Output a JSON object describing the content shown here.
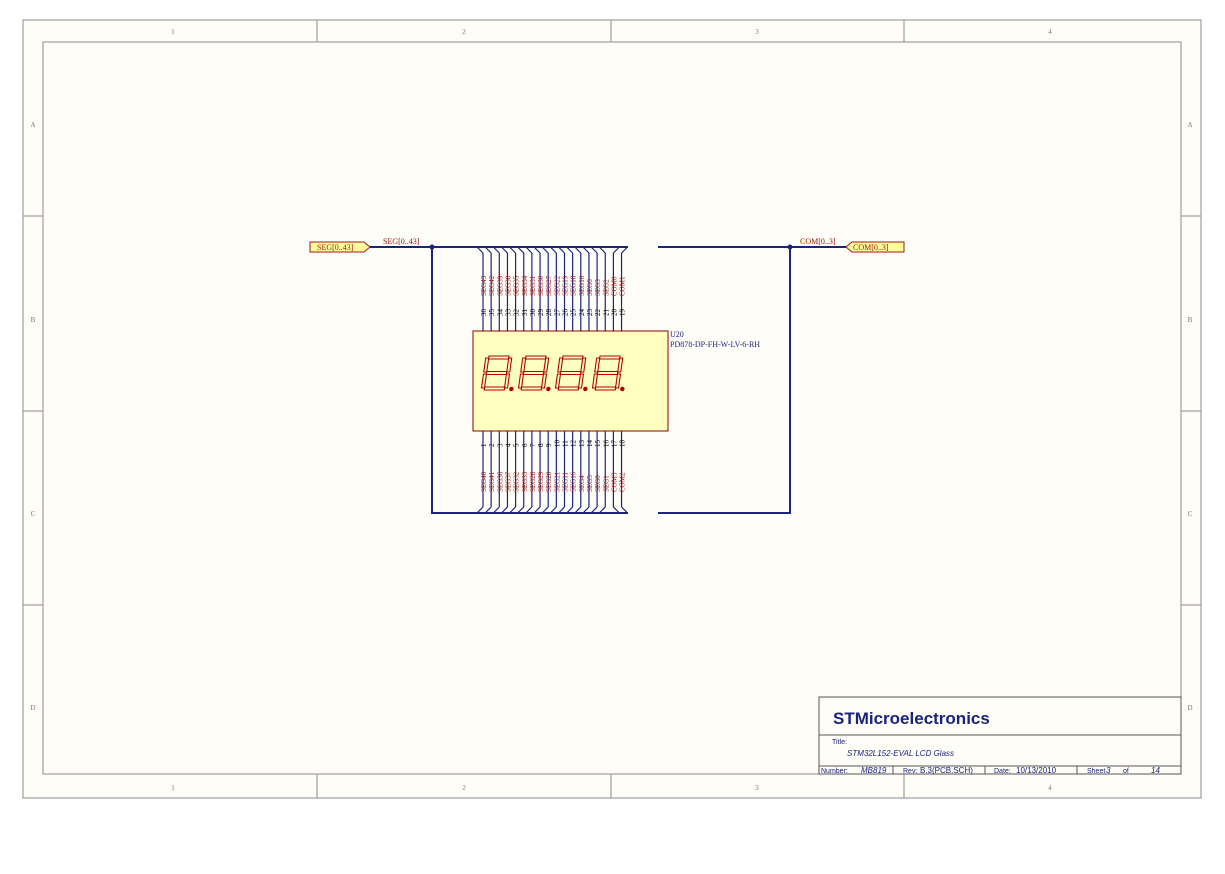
{
  "border": {
    "columns": [
      "1",
      "2",
      "3",
      "4"
    ],
    "rows": [
      "A",
      "B",
      "C",
      "D"
    ]
  },
  "ports": {
    "seg_port": "SEG[0..43]",
    "seg_net": "SEG[0..43]",
    "com_net": "COM[0..3]",
    "com_port": "COM[0..3]"
  },
  "component": {
    "designator": "U20",
    "part": "PD878-DP-FH-W-LV-6-RH",
    "display_digits": "8.8.8.8."
  },
  "top_pins": [
    {
      "num": "36",
      "net": "SEG43",
      "inner": "S31"
    },
    {
      "num": "35",
      "net": "SEG42",
      "inner": "S30"
    },
    {
      "num": "34",
      "net": "SEG39",
      "inner": "S27"
    },
    {
      "num": "33",
      "net": "SEG38",
      "inner": "S26"
    },
    {
      "num": "32",
      "net": "SEG35",
      "inner": "S23"
    },
    {
      "num": "31",
      "net": "SEG34",
      "inner": "S22"
    },
    {
      "num": "30",
      "net": "SEG31",
      "inner": "S19"
    },
    {
      "num": "29",
      "net": "SEG30",
      "inner": "S18"
    },
    {
      "num": "28",
      "net": "SEG27",
      "inner": "S15"
    },
    {
      "num": "27",
      "net": "SEG22",
      "inner": "S14"
    },
    {
      "num": "26",
      "net": "SEG19",
      "inner": "S11"
    },
    {
      "num": "25",
      "net": "SEG18",
      "inner": "S10"
    },
    {
      "num": "24",
      "net": "SEG10",
      "inner": "S7"
    },
    {
      "num": "23",
      "net": "SEG6",
      "inner": "S6"
    },
    {
      "num": "22",
      "net": "SEG3",
      "inner": "S3"
    },
    {
      "num": "21",
      "net": "SEG2",
      "inner": "S2"
    },
    {
      "num": "20",
      "net": "COM0",
      "inner": "COM1"
    },
    {
      "num": "19",
      "net": "COM1",
      "inner": "COM2"
    }
  ],
  "bottom_pins": [
    {
      "num": "1",
      "net": "SEG40",
      "inner": "S28"
    },
    {
      "num": "2",
      "net": "SEG41",
      "inner": "S29"
    },
    {
      "num": "3",
      "net": "SEG36",
      "inner": "S24"
    },
    {
      "num": "4",
      "net": "SEG37",
      "inner": "S25"
    },
    {
      "num": "5",
      "net": "SEG32",
      "inner": "S20"
    },
    {
      "num": "6",
      "net": "SEG33",
      "inner": "S21"
    },
    {
      "num": "7",
      "net": "SEG28",
      "inner": "S16"
    },
    {
      "num": "8",
      "net": "SEG29",
      "inner": "S17"
    },
    {
      "num": "9",
      "net": "SEG20",
      "inner": "S12"
    },
    {
      "num": "10",
      "net": "SEG21",
      "inner": "S13"
    },
    {
      "num": "11",
      "net": "SEG11",
      "inner": "S8"
    },
    {
      "num": "12",
      "net": "SEG16",
      "inner": "S9"
    },
    {
      "num": "13",
      "net": "SEG4",
      "inner": "S4"
    },
    {
      "num": "14",
      "net": "SEG5",
      "inner": "S5"
    },
    {
      "num": "15",
      "net": "SEG0",
      "inner": "S0"
    },
    {
      "num": "16",
      "net": "SEG1",
      "inner": "S1"
    },
    {
      "num": "17",
      "net": "COM3",
      "inner": "COM4"
    },
    {
      "num": "18",
      "net": "COM2",
      "inner": "COM3"
    }
  ],
  "title_block": {
    "company": "STMicroelectronics",
    "title_label": "Title:",
    "title": "STM32L152-EVAL LCD Glass",
    "number_label": "Number:",
    "number": "MB819",
    "rev_label": "Rev:",
    "rev": "B.3(PCB.SCH)",
    "date_label": "Date:",
    "date": "10/13/2010",
    "sheet_label": "Sheet",
    "sheet": "3",
    "of_label": "of",
    "total": "14"
  },
  "colors": {
    "wire": "#1a237e",
    "net_text": "#a31515",
    "port_fill": "#ffff99",
    "component_fill": "#ffffc0",
    "sheet_fill": "#fffdf7",
    "border": "#8c8c8c"
  }
}
